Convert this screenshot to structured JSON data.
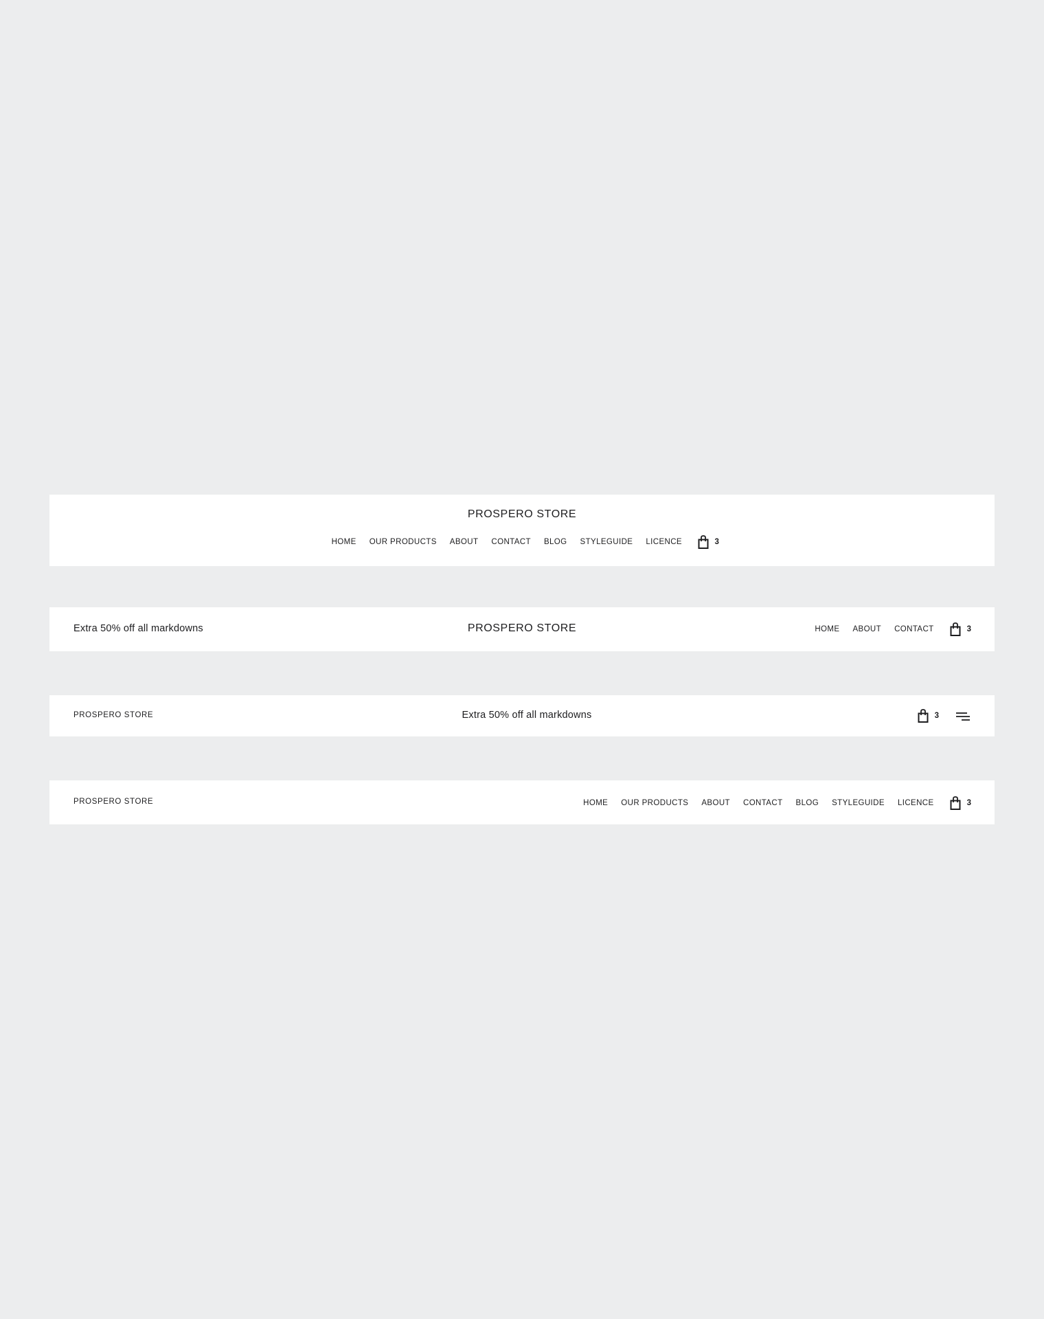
{
  "brand": "PROSPERO STORE",
  "promo": "Extra 50% off all markdowns",
  "cart_count": "3",
  "nav_full": [
    "HOME",
    "OUR PRODUCTS",
    "ABOUT",
    "CONTACT",
    "BLOG",
    "STYLEGUIDE",
    "LICENCE"
  ],
  "nav_short": [
    "HOME",
    "ABOUT",
    "CONTACT"
  ],
  "icons": {
    "cart": "shopping-bag-icon",
    "menu": "hamburger-menu-icon"
  },
  "colors": {
    "background": "#ecedee",
    "bar": "#ffffff",
    "text": "#1d1d1f"
  }
}
